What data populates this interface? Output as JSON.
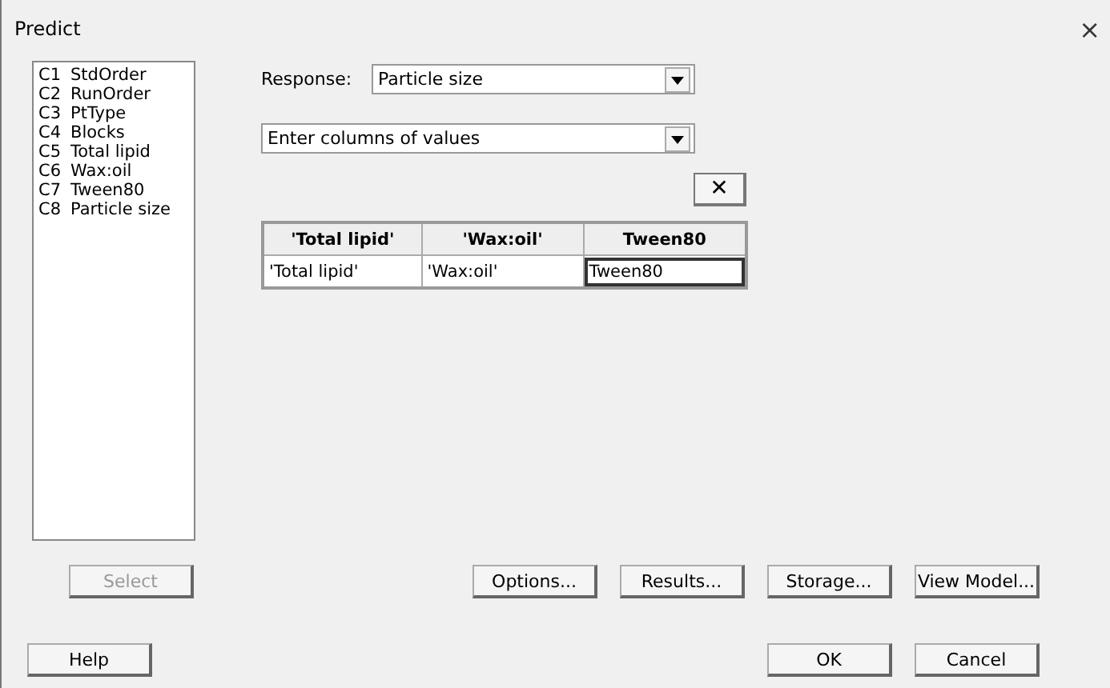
{
  "window": {
    "title": "Predict",
    "close": "×"
  },
  "columns_list": [
    {
      "id": "C1",
      "name": "StdOrder"
    },
    {
      "id": "C2",
      "name": "RunOrder"
    },
    {
      "id": "C3",
      "name": "PtType"
    },
    {
      "id": "C4",
      "name": "Blocks"
    },
    {
      "id": "C5",
      "name": "Total lipid"
    },
    {
      "id": "C6",
      "name": "Wax:oil"
    },
    {
      "id": "C7",
      "name": "Tween80"
    },
    {
      "id": "C8",
      "name": "Particle size"
    }
  ],
  "response": {
    "label": "Response:",
    "value": "Particle size"
  },
  "mode": {
    "value": "Enter columns of values"
  },
  "clear_button": {
    "label": "✕"
  },
  "table": {
    "columns": [
      "'Total lipid'",
      "'Wax:oil'",
      "Tween80"
    ],
    "rows": [
      [
        {
          "text": "'Total lipid'",
          "selected": false
        },
        {
          "text": "'Wax:oil'",
          "selected": false
        },
        {
          "text": "Tween80",
          "selected": true
        }
      ]
    ]
  },
  "action_buttons": [
    {
      "label": "Options...",
      "disabled": false
    },
    {
      "label": "Results...",
      "disabled": false
    },
    {
      "label": "Storage...",
      "disabled": false
    },
    {
      "label": "View Model...",
      "disabled": false
    }
  ],
  "select_button": {
    "label": "Select",
    "disabled": true
  },
  "help_button": {
    "label": "Help",
    "disabled": false
  },
  "dialog_buttons": [
    {
      "label": "OK",
      "disabled": false
    },
    {
      "label": "Cancel",
      "disabled": false
    }
  ]
}
